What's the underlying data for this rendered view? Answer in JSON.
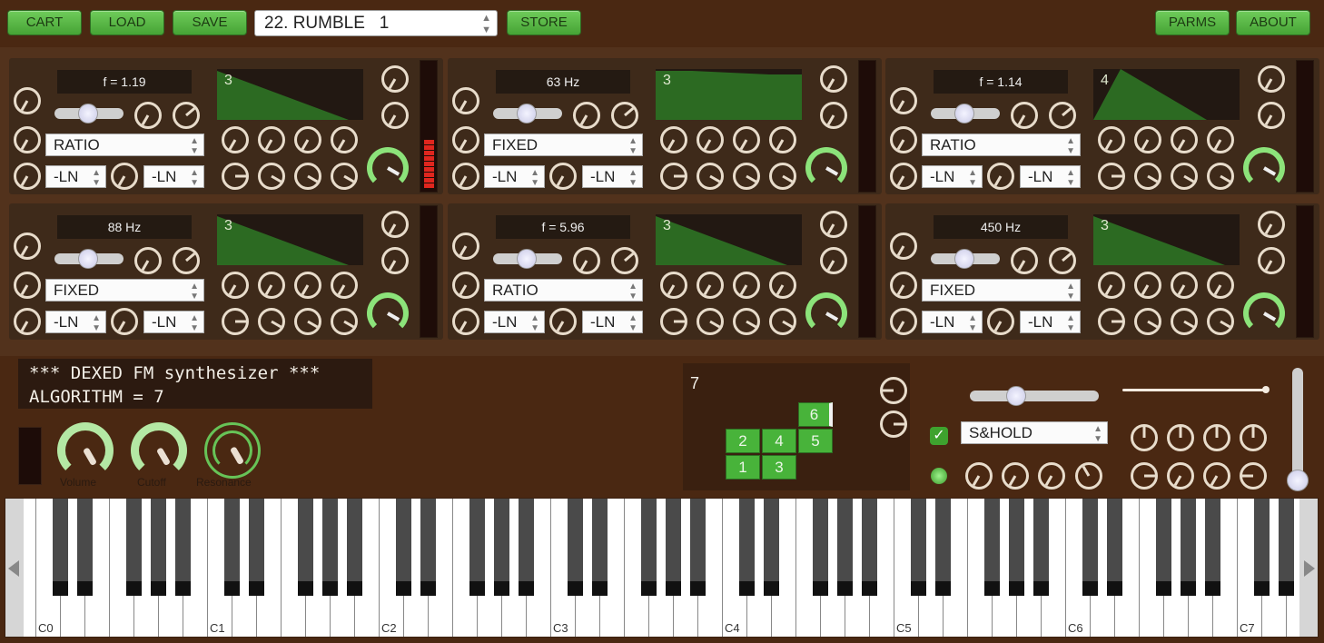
{
  "toolbar": {
    "buttons": [
      "CART",
      "LOAD",
      "SAVE"
    ],
    "program": "22. RUMBLE   1",
    "store_label": "STORE",
    "parms_label": "PARMS",
    "about_label": "ABOUT"
  },
  "operators": [
    {
      "id": 1,
      "freq_display": "f = 1.19",
      "mode": "RATIO",
      "left_curve": "-LN",
      "right_curve": "-LN",
      "env_label": "3",
      "meter_level": 0.45
    },
    {
      "id": 2,
      "freq_display": "63 Hz",
      "mode": "FIXED",
      "left_curve": "-LN",
      "right_curve": "-LN",
      "env_label": "3",
      "meter_level": 0
    },
    {
      "id": 3,
      "freq_display": "f = 1.14",
      "mode": "RATIO",
      "left_curve": "-LN",
      "right_curve": "-LN",
      "env_label": "4",
      "meter_level": 0
    },
    {
      "id": 4,
      "freq_display": "88 Hz",
      "mode": "FIXED",
      "left_curve": "-LN",
      "right_curve": "-LN",
      "env_label": "3",
      "meter_level": 0
    },
    {
      "id": 5,
      "freq_display": "f = 5.96",
      "mode": "RATIO",
      "left_curve": "-LN",
      "right_curve": "-LN",
      "env_label": "3",
      "meter_level": 0
    },
    {
      "id": 6,
      "freq_display": "450 Hz",
      "mode": "FIXED",
      "left_curve": "-LN",
      "right_curve": "-LN",
      "env_label": "3",
      "meter_level": 0
    }
  ],
  "lcd": {
    "line1": "*** DEXED FM synthesizer ***",
    "line2": "ALGORITHM = 7"
  },
  "global_knobs": {
    "volume_label": "Volume",
    "cutoff_label": "Cutoff",
    "resonance_label": "Resonance"
  },
  "algorithm": {
    "number": "7",
    "boxes": [
      "6",
      "2",
      "4",
      "5",
      "1",
      "3"
    ]
  },
  "lfo": {
    "waveform": "S&HOLD",
    "sync_checked": true
  },
  "keyboard": {
    "octave_labels": [
      "C0",
      "C1",
      "C2",
      "C3",
      "C4",
      "C5",
      "C6",
      "C7"
    ],
    "scroll_left_icon": "triangle-left",
    "scroll_right_icon": "triangle-right"
  },
  "colors": {
    "background": "#4a2812",
    "panel": "#3e2a1a",
    "accent_green": "#48b33a",
    "meter_red": "#e0261e"
  }
}
